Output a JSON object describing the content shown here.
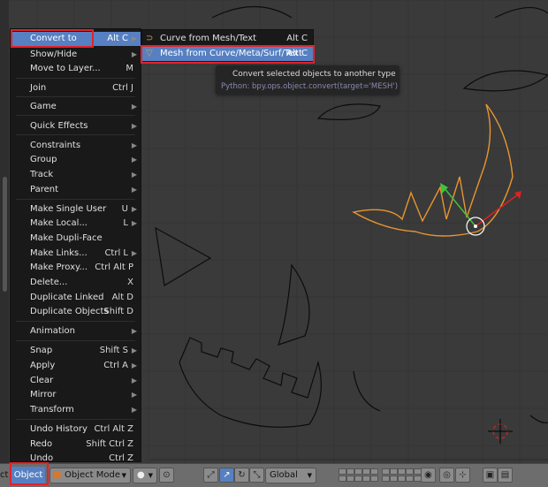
{
  "menu": {
    "items": [
      {
        "label": "Convert to",
        "shortcut": "Alt C",
        "arrow": true,
        "highlighted": true
      },
      {
        "label": "Show/Hide",
        "shortcut": "",
        "arrow": true
      },
      {
        "label": "Move to Layer...",
        "shortcut": "M",
        "arrow": false
      },
      {
        "label": "Join",
        "shortcut": "Ctrl J",
        "arrow": false
      },
      {
        "label": "Game",
        "shortcut": "",
        "arrow": true
      },
      {
        "label": "Quick Effects",
        "shortcut": "",
        "arrow": true
      },
      {
        "label": "Constraints",
        "shortcut": "",
        "arrow": true
      },
      {
        "label": "Group",
        "shortcut": "",
        "arrow": true
      },
      {
        "label": "Track",
        "shortcut": "",
        "arrow": true
      },
      {
        "label": "Parent",
        "shortcut": "",
        "arrow": true
      },
      {
        "label": "Make Single User",
        "shortcut": "U",
        "arrow": true
      },
      {
        "label": "Make Local...",
        "shortcut": "L",
        "arrow": true
      },
      {
        "label": "Make Dupli-Face",
        "shortcut": "",
        "arrow": false
      },
      {
        "label": "Make Links...",
        "shortcut": "Ctrl L",
        "arrow": true
      },
      {
        "label": "Make Proxy...",
        "shortcut": "Ctrl Alt P",
        "arrow": false
      },
      {
        "label": "Delete...",
        "shortcut": "X",
        "arrow": false
      },
      {
        "label": "Duplicate Linked",
        "shortcut": "Alt D",
        "arrow": false
      },
      {
        "label": "Duplicate Objects",
        "shortcut": "Shift D",
        "arrow": false
      },
      {
        "label": "Animation",
        "shortcut": "",
        "arrow": true
      },
      {
        "label": "Snap",
        "shortcut": "Shift S",
        "arrow": true
      },
      {
        "label": "Apply",
        "shortcut": "Ctrl A",
        "arrow": true
      },
      {
        "label": "Clear",
        "shortcut": "",
        "arrow": true
      },
      {
        "label": "Mirror",
        "shortcut": "",
        "arrow": true
      },
      {
        "label": "Transform",
        "shortcut": "",
        "arrow": true
      },
      {
        "label": "Undo History",
        "shortcut": "Ctrl Alt Z",
        "arrow": false
      },
      {
        "label": "Redo",
        "shortcut": "Shift Ctrl Z",
        "arrow": false
      },
      {
        "label": "Undo",
        "shortcut": "Ctrl Z",
        "arrow": false
      }
    ]
  },
  "submenu": {
    "items": [
      {
        "label": "Curve from Mesh/Text",
        "shortcut": "Alt C",
        "icon": "curve-icon"
      },
      {
        "label": "Mesh from Curve/Meta/Surf/Text",
        "shortcut": "Alt C",
        "icon": "mesh-icon",
        "highlighted": true
      }
    ]
  },
  "tooltip": {
    "description": "Convert selected objects to another type",
    "python": "Python: bpy.ops.object.convert(target='MESH')"
  },
  "header": {
    "left_cut_label": "ct",
    "object_menu": "Object",
    "mode": "Object Mode",
    "orientation": "Global"
  },
  "colors": {
    "menu_highlight": "#5680c2",
    "annotation_red": "#e2222a",
    "selected_outline": "#e8952f",
    "viewport_bg": "#3a3a3a"
  }
}
